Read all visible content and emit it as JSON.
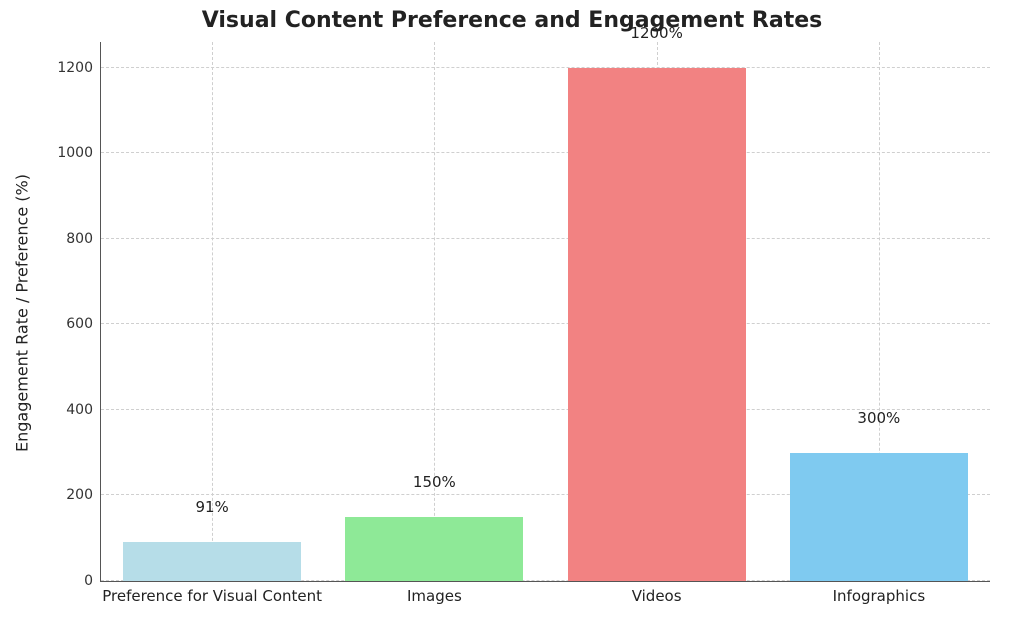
{
  "chart_data": {
    "type": "bar",
    "title": "Visual Content Preference and Engagement Rates",
    "ylabel": "Engagement Rate / Preference (%)",
    "xlabel": "",
    "categories": [
      "Preference for Visual Content",
      "Images",
      "Videos",
      "Infographics"
    ],
    "values": [
      91,
      150,
      1200,
      300
    ],
    "bar_labels": [
      "91%",
      "150%",
      "1200%",
      "300%"
    ],
    "colors": [
      "#b6dde8",
      "#8ee997",
      "#f28282",
      "#7fcaf0"
    ],
    "y_ticks": [
      0,
      200,
      400,
      600,
      800,
      1000,
      1200
    ],
    "ylim": [
      0,
      1260
    ]
  }
}
